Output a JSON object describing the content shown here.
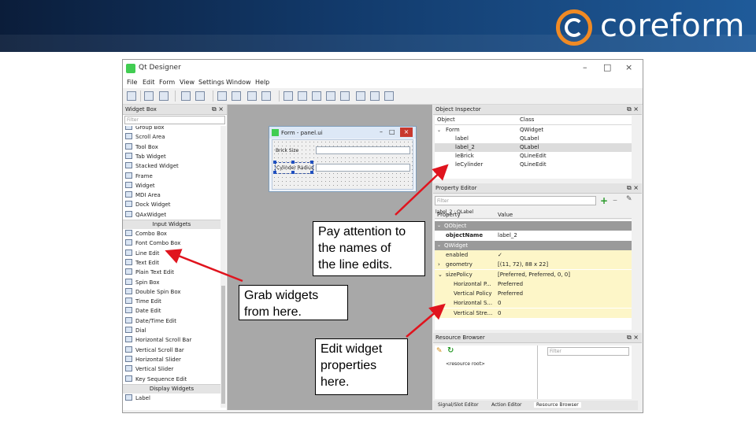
{
  "logo": {
    "text": "coreform"
  },
  "window": {
    "title": "Qt Designer",
    "menu": [
      "File",
      "Edit",
      "Form",
      "View",
      "Settings",
      "Window",
      "Help"
    ],
    "controls": {
      "minimize": "–",
      "maximize": "□",
      "close": "×"
    }
  },
  "widget_box": {
    "title": "Widget Box",
    "filter_placeholder": "Filter",
    "items": [
      {
        "label": "Group Box"
      },
      {
        "label": "Scroll Area"
      },
      {
        "label": "Tool Box"
      },
      {
        "label": "Tab Widget"
      },
      {
        "label": "Stacked Widget"
      },
      {
        "label": "Frame"
      },
      {
        "label": "Widget"
      },
      {
        "label": "MDI Area"
      },
      {
        "label": "Dock Widget"
      },
      {
        "label": "QAxWidget"
      },
      {
        "category": "Input Widgets"
      },
      {
        "label": "Combo Box"
      },
      {
        "label": "Font Combo Box"
      },
      {
        "label": "Line Edit"
      },
      {
        "label": "Text Edit"
      },
      {
        "label": "Plain Text Edit"
      },
      {
        "label": "Spin Box"
      },
      {
        "label": "Double Spin Box"
      },
      {
        "label": "Time Edit"
      },
      {
        "label": "Date Edit"
      },
      {
        "label": "Date/Time Edit"
      },
      {
        "label": "Dial"
      },
      {
        "label": "Horizontal Scroll Bar"
      },
      {
        "label": "Vertical Scroll Bar"
      },
      {
        "label": "Horizontal Slider"
      },
      {
        "label": "Vertical Slider"
      },
      {
        "label": "Key Sequence Edit"
      },
      {
        "category": "Display Widgets"
      },
      {
        "label": "Label"
      }
    ]
  },
  "form": {
    "title": "Form - panel.ui",
    "labels": [
      "Brick Size",
      "Cylinder Radius"
    ]
  },
  "object_inspector": {
    "title": "Object Inspector",
    "headers": [
      "Object",
      "Class"
    ],
    "rows": [
      {
        "object": "Form",
        "class": "QWidget"
      },
      {
        "object": "label",
        "class": "QLabel"
      },
      {
        "object": "label_2",
        "class": "QLabel"
      },
      {
        "object": "leBrick",
        "class": "QLineEdit"
      },
      {
        "object": "leCylinder",
        "class": "QLineEdit"
      }
    ]
  },
  "property_editor": {
    "title": "Property Editor",
    "filter_placeholder": "Filter",
    "context": "label_2 : QLabel",
    "headers": [
      "Property",
      "Value"
    ],
    "rows": [
      {
        "prop": "QObject",
        "value": "",
        "section": true
      },
      {
        "prop": "objectName",
        "value": "label_2"
      },
      {
        "prop": "QWidget",
        "value": "",
        "section": true
      },
      {
        "prop": "enabled",
        "value": "✓"
      },
      {
        "prop": "geometry",
        "value": "[(11, 72), 88 x 22]"
      },
      {
        "prop": "sizePolicy",
        "value": "[Preferred, Preferred, 0, 0]"
      },
      {
        "prop": "Horizontal P...",
        "value": "Preferred"
      },
      {
        "prop": "Vertical Policy",
        "value": "Preferred"
      },
      {
        "prop": "Horizontal S...",
        "value": "0"
      },
      {
        "prop": "Vertical Stre...",
        "value": "0"
      }
    ]
  },
  "resource_browser": {
    "title": "Resource Browser",
    "filter_placeholder": "Filter",
    "root": "<resource root>"
  },
  "bottom_tabs": [
    "Signal/Slot Editor",
    "Action Editor",
    "Resource Browser"
  ],
  "callouts": {
    "line_edits": [
      "Pay attention to",
      "the names of",
      "the line edits."
    ],
    "grab": [
      "Grab widgets",
      "from here."
    ],
    "edit": [
      "Edit widget",
      "properties",
      "here."
    ]
  },
  "colors": {
    "arrow": "#e0141e",
    "banner": "#123a6b",
    "logo_accent": "#f08a24"
  }
}
